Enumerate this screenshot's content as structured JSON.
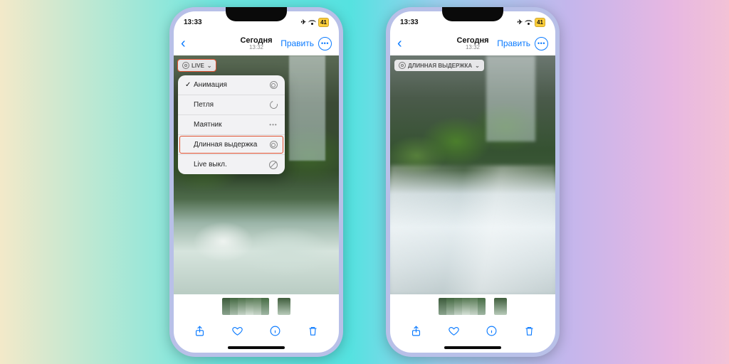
{
  "status": {
    "time": "13:33",
    "battery": "41"
  },
  "nav": {
    "title": "Сегодня",
    "subtitle": "13:32",
    "edit": "Править"
  },
  "left": {
    "badge": "LIVE",
    "menu": [
      {
        "label": "Анимация",
        "checked": true,
        "icon": "ring-dbl",
        "hl": false
      },
      {
        "label": "Петля",
        "checked": false,
        "icon": "loop",
        "hl": false
      },
      {
        "label": "Маятник",
        "checked": false,
        "icon": "dots",
        "hl": false
      },
      {
        "label": "Длинная выдержка",
        "checked": false,
        "icon": "ring-dbl",
        "hl": true
      },
      {
        "label": "Live выкл.",
        "checked": false,
        "icon": "off",
        "hl": false
      }
    ]
  },
  "right": {
    "badge": "ДЛИННАЯ ВЫДЕРЖКА"
  }
}
